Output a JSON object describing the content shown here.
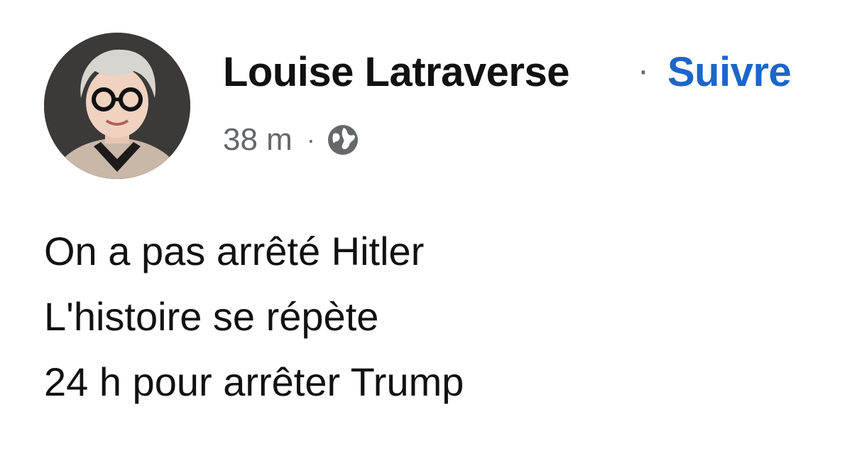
{
  "post": {
    "author": "Louise Latraverse",
    "separator": "·",
    "follow_label": "Suivre",
    "timestamp": "38 m",
    "meta_separator": "·",
    "audience_icon": "globe-icon",
    "lines": [
      "On a pas arrêté Hitler",
      "L'histoire se répète",
      "24 h pour arrêter Trump"
    ]
  },
  "colors": {
    "follow": "#1b66c9",
    "meta": "#65676b",
    "text": "#111111"
  }
}
